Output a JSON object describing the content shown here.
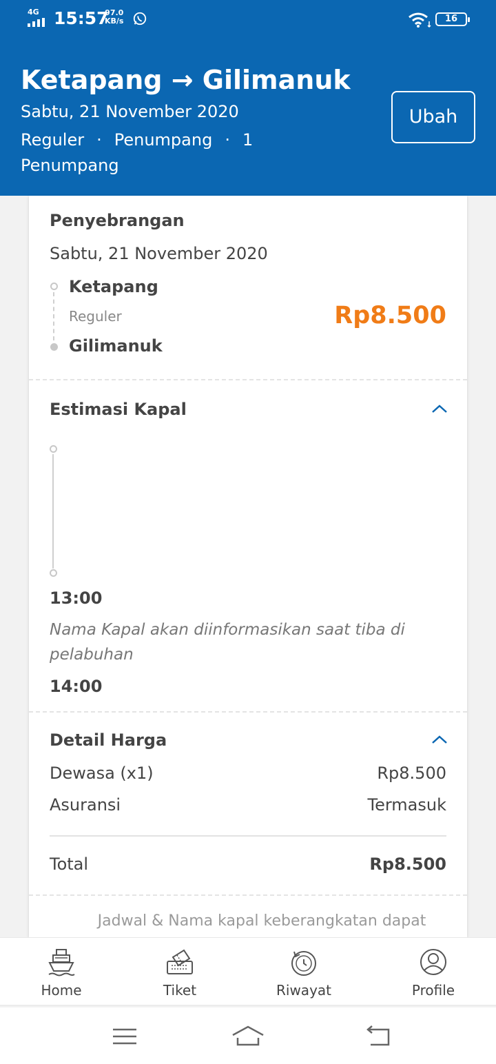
{
  "status_bar": {
    "network": "4G",
    "time": "15:57",
    "speed_value": "97.0",
    "speed_unit": "KB/s",
    "battery": "16"
  },
  "header": {
    "origin": "Ketapang",
    "arrow": "→",
    "destination": "Gilimanuk",
    "date": "Sabtu, 21 November 2020",
    "service_class": "Reguler",
    "passenger_type": "Penumpang",
    "passenger_count_text": "1 Penumpang",
    "change_button": "Ubah"
  },
  "trip": {
    "title": "Penyebrangan",
    "date": "Sabtu, 21 November 2020",
    "origin": "Ketapang",
    "class": "Reguler",
    "destination": "Gilimanuk",
    "price": "Rp8.500"
  },
  "ship_estimate": {
    "title": "Estimasi Kapal",
    "departure_time": "13:00",
    "ship_note": "Nama Kapal akan diinformasikan saat tiba di pelabuhan",
    "arrival_time": "14:00"
  },
  "price_detail": {
    "title": "Detail Harga",
    "rows": [
      {
        "label": "Dewasa (x1)",
        "value": "Rp8.500"
      },
      {
        "label": "Asuransi",
        "value": "Termasuk"
      }
    ],
    "total_label": "Total",
    "total_value": "Rp8.500",
    "note": "Jadwal & Nama kapal keberangkatan dapat"
  },
  "bottom_nav": {
    "items": [
      {
        "label": "Home",
        "icon": "ship-icon"
      },
      {
        "label": "Tiket",
        "icon": "ticket-icon"
      },
      {
        "label": "Riwayat",
        "icon": "history-icon"
      },
      {
        "label": "Profile",
        "icon": "profile-icon"
      }
    ]
  },
  "colors": {
    "primary": "#0b67b2",
    "price": "#f07c17",
    "chevron": "#0b67b2"
  }
}
